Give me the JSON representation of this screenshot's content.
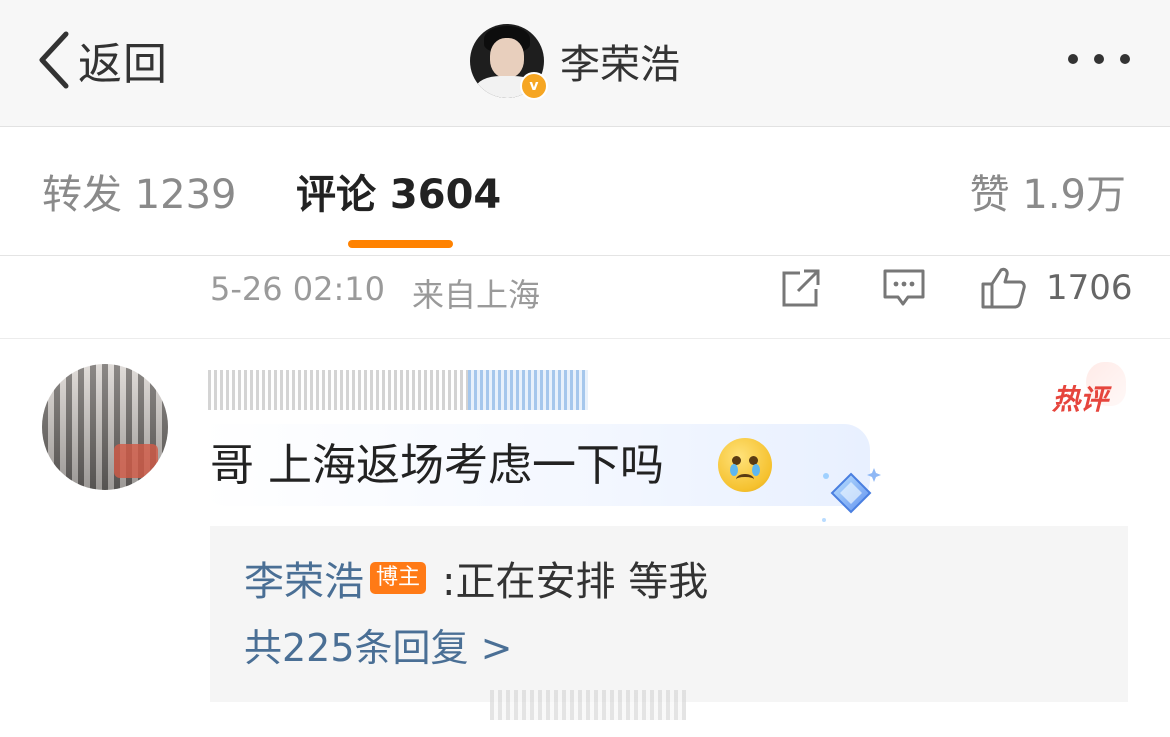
{
  "nav": {
    "back_label": "返回",
    "title": "李荣浩",
    "verified_badge": "v"
  },
  "tabs": {
    "repost": "转发 1239",
    "comment": "评论 3604",
    "like": "赞 1.9万",
    "active": "comment"
  },
  "post_meta": {
    "time": "5-26 02:10",
    "source": "来自上海",
    "like_count": "1706"
  },
  "comment": {
    "badge": "热评",
    "text": "哥 上海返场考虑一下吗",
    "emoji": "crying-face",
    "reply": {
      "author": "李荣浩",
      "author_badge": "博主",
      "text": ":正在安排 等我",
      "more_replies": "共225条回复 >"
    }
  },
  "colors": {
    "accent": "#ff8200",
    "link": "#4a6f95",
    "hot": "#e6453d"
  }
}
